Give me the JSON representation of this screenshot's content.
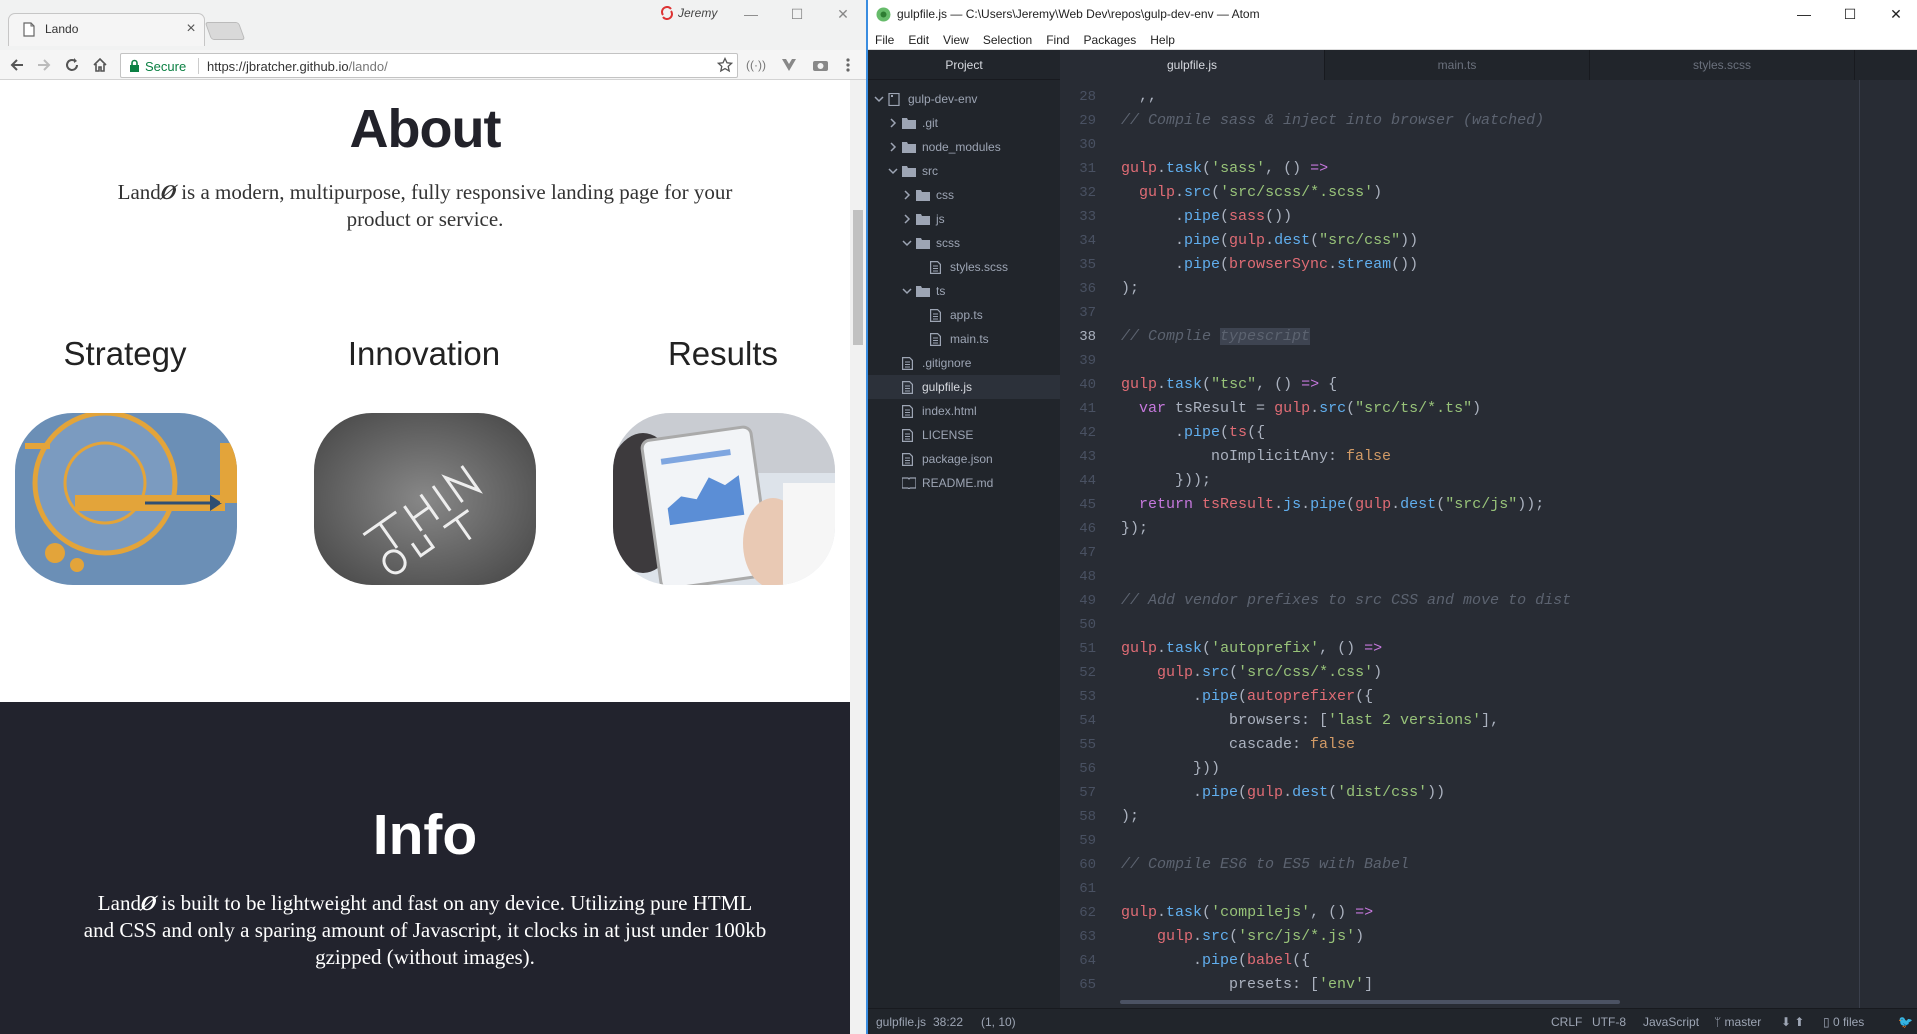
{
  "chrome": {
    "tab_title": "Lando",
    "profile_name": "Jeremy",
    "secure_label": "Secure",
    "url_host": "https://jbratcher.github.io",
    "url_path": "/lando/",
    "controls": {
      "minimize": "—",
      "maximize": "☐",
      "close": "✕"
    }
  },
  "page": {
    "about_title": "About",
    "about_text_prefix": "Land",
    "about_text_rest": " is a modern, multipurpose, fully responsive landing page for your product or service.",
    "features": [
      {
        "title": "Strategy",
        "image": "strategy-image"
      },
      {
        "title": "Innovation",
        "image": "innovation-chalkboard-image"
      },
      {
        "title": "Results",
        "image": "results-tablet-image"
      }
    ],
    "info_title": "Info",
    "info_text_prefix": "Land",
    "info_text_rest": " is built to be lightweight and fast on any device. Utilizing pure HTML and CSS and only a sparing amount of Javascript, it clocks in at just under 100kb gzipped (without images)."
  },
  "atom": {
    "window_title": "gulpfile.js — C:\\Users\\Jeremy\\Web Dev\\repos\\gulp-dev-env — Atom",
    "menu": [
      "File",
      "Edit",
      "View",
      "Selection",
      "Find",
      "Packages",
      "Help"
    ],
    "tree_header": "Project",
    "tree": [
      {
        "label": "gulp-dev-env",
        "type": "repo",
        "depth": 0,
        "expanded": true
      },
      {
        "label": ".git",
        "type": "folder",
        "depth": 1,
        "expanded": false
      },
      {
        "label": "node_modules",
        "type": "folder",
        "depth": 1,
        "expanded": false
      },
      {
        "label": "src",
        "type": "folder",
        "depth": 1,
        "expanded": true
      },
      {
        "label": "css",
        "type": "folder",
        "depth": 2,
        "expanded": false
      },
      {
        "label": "js",
        "type": "folder",
        "depth": 2,
        "expanded": false
      },
      {
        "label": "scss",
        "type": "folder",
        "depth": 2,
        "expanded": true
      },
      {
        "label": "styles.scss",
        "type": "file",
        "depth": 3
      },
      {
        "label": "ts",
        "type": "folder",
        "depth": 2,
        "expanded": true
      },
      {
        "label": "app.ts",
        "type": "file",
        "depth": 3
      },
      {
        "label": "main.ts",
        "type": "file",
        "depth": 3
      },
      {
        "label": ".gitignore",
        "type": "file",
        "depth": 1
      },
      {
        "label": "gulpfile.js",
        "type": "file",
        "depth": 1,
        "selected": true
      },
      {
        "label": "index.html",
        "type": "file",
        "depth": 1
      },
      {
        "label": "LICENSE",
        "type": "file",
        "depth": 1
      },
      {
        "label": "package.json",
        "type": "file",
        "depth": 1
      },
      {
        "label": "README.md",
        "type": "book",
        "depth": 1
      }
    ],
    "tabs": [
      {
        "label": "gulpfile.js",
        "active": true
      },
      {
        "label": "main.ts",
        "active": false
      },
      {
        "label": "styles.scss",
        "active": false
      }
    ],
    "current_line": 38,
    "code": [
      {
        "n": 28,
        "t": [
          [
            "pn",
            "  ,,"
          ]
        ]
      },
      {
        "n": 29,
        "t": [
          [
            "cm",
            "// Compile sass & inject into browser (watched)"
          ]
        ]
      },
      {
        "n": 30,
        "t": []
      },
      {
        "n": 31,
        "t": [
          [
            "fn",
            "gulp"
          ],
          [
            "pn",
            "."
          ],
          [
            "fn",
            "task"
          ],
          [
            "pn",
            "("
          ],
          [
            "st",
            "'sass'"
          ],
          [
            "pn",
            ", () "
          ],
          [
            "kw",
            "=>"
          ]
        ]
      },
      {
        "n": 32,
        "t": [
          [
            "pn",
            "  "
          ],
          [
            "fn",
            "gulp"
          ],
          [
            "pn",
            "."
          ],
          [
            "fn",
            "src"
          ],
          [
            "pn",
            "("
          ],
          [
            "st",
            "'src/scss/*.scss'"
          ],
          [
            "pn",
            ")"
          ]
        ]
      },
      {
        "n": 33,
        "t": [
          [
            "pn",
            "      ."
          ],
          [
            "fn",
            "pipe"
          ],
          [
            "pn",
            "("
          ],
          [
            "fn",
            "sass"
          ],
          [
            "pn",
            "())"
          ]
        ]
      },
      {
        "n": 34,
        "t": [
          [
            "pn",
            "      ."
          ],
          [
            "fn",
            "pipe"
          ],
          [
            "pn",
            "("
          ],
          [
            "fn",
            "gulp"
          ],
          [
            "pn",
            "."
          ],
          [
            "fn",
            "dest"
          ],
          [
            "pn",
            "("
          ],
          [
            "st",
            "\"src/css\""
          ],
          [
            "pn",
            "))"
          ]
        ]
      },
      {
        "n": 35,
        "t": [
          [
            "pn",
            "      ."
          ],
          [
            "fn",
            "pipe"
          ],
          [
            "pn",
            "("
          ],
          [
            "fn",
            "browserSync"
          ],
          [
            "pn",
            "."
          ],
          [
            "fn",
            "stream"
          ],
          [
            "pn",
            "())"
          ]
        ]
      },
      {
        "n": 36,
        "t": [
          [
            "pn",
            ");"
          ]
        ]
      },
      {
        "n": 37,
        "t": []
      },
      {
        "n": 38,
        "t": [
          [
            "cm",
            "// Complie "
          ],
          [
            "hl",
            "typescript"
          ]
        ]
      },
      {
        "n": 39,
        "t": []
      },
      {
        "n": 40,
        "t": [
          [
            "fn",
            "gulp"
          ],
          [
            "pn",
            "."
          ],
          [
            "fn",
            "task"
          ],
          [
            "pn",
            "("
          ],
          [
            "st",
            "\"tsc\""
          ],
          [
            "pn",
            ", () "
          ],
          [
            "kw",
            "=>"
          ],
          [
            "pn",
            " {"
          ]
        ]
      },
      {
        "n": 41,
        "t": [
          [
            "pn",
            "  "
          ],
          [
            "kw",
            "var"
          ],
          [
            "pn",
            " tsResult = "
          ],
          [
            "fn",
            "gulp"
          ],
          [
            "pn",
            "."
          ],
          [
            "fn",
            "src"
          ],
          [
            "pn",
            "("
          ],
          [
            "st",
            "\"src/ts/*.ts\""
          ],
          [
            "pn",
            ")"
          ]
        ]
      },
      {
        "n": 42,
        "t": [
          [
            "pn",
            "      ."
          ],
          [
            "fn",
            "pipe"
          ],
          [
            "pn",
            "("
          ],
          [
            "fn",
            "ts"
          ],
          [
            "pn",
            "({"
          ]
        ]
      },
      {
        "n": 43,
        "t": [
          [
            "pn",
            "          noImplicitAny: "
          ],
          [
            "nm",
            "false"
          ]
        ]
      },
      {
        "n": 44,
        "t": [
          [
            "pn",
            "      }));"
          ]
        ]
      },
      {
        "n": 45,
        "t": [
          [
            "pn",
            "  "
          ],
          [
            "kw",
            "return"
          ],
          [
            "pn",
            " "
          ],
          [
            "fn",
            "tsResult"
          ],
          [
            "pn",
            "."
          ],
          [
            "fn",
            "js"
          ],
          [
            "pn",
            "."
          ],
          [
            "fn",
            "pipe"
          ],
          [
            "pn",
            "("
          ],
          [
            "fn",
            "gulp"
          ],
          [
            "pn",
            "."
          ],
          [
            "fn",
            "dest"
          ],
          [
            "pn",
            "("
          ],
          [
            "st",
            "\"src/js\""
          ],
          [
            "pn",
            "));"
          ]
        ]
      },
      {
        "n": 46,
        "t": [
          [
            "pn",
            "});"
          ]
        ]
      },
      {
        "n": 47,
        "t": []
      },
      {
        "n": 48,
        "t": []
      },
      {
        "n": 49,
        "t": [
          [
            "cm",
            "// Add vendor prefixes to src CSS and move to dist"
          ]
        ]
      },
      {
        "n": 50,
        "t": []
      },
      {
        "n": 51,
        "t": [
          [
            "fn",
            "gulp"
          ],
          [
            "pn",
            "."
          ],
          [
            "fn",
            "task"
          ],
          [
            "pn",
            "("
          ],
          [
            "st",
            "'autoprefix'"
          ],
          [
            "pn",
            ", () "
          ],
          [
            "kw",
            "=>"
          ]
        ]
      },
      {
        "n": 52,
        "t": [
          [
            "pn",
            "    "
          ],
          [
            "fn",
            "gulp"
          ],
          [
            "pn",
            "."
          ],
          [
            "fn",
            "src"
          ],
          [
            "pn",
            "("
          ],
          [
            "st",
            "'src/css/*.css'"
          ],
          [
            "pn",
            ")"
          ]
        ]
      },
      {
        "n": 53,
        "t": [
          [
            "pn",
            "        ."
          ],
          [
            "fn",
            "pipe"
          ],
          [
            "pn",
            "("
          ],
          [
            "fn",
            "autoprefixer"
          ],
          [
            "pn",
            "({"
          ]
        ]
      },
      {
        "n": 54,
        "t": [
          [
            "pn",
            "            browsers: ["
          ],
          [
            "st",
            "'last 2 versions'"
          ],
          [
            "pn",
            "],"
          ]
        ]
      },
      {
        "n": 55,
        "t": [
          [
            "pn",
            "            cascade: "
          ],
          [
            "nm",
            "false"
          ]
        ]
      },
      {
        "n": 56,
        "t": [
          [
            "pn",
            "        }))"
          ]
        ]
      },
      {
        "n": 57,
        "t": [
          [
            "pn",
            "        ."
          ],
          [
            "fn",
            "pipe"
          ],
          [
            "pn",
            "("
          ],
          [
            "fn",
            "gulp"
          ],
          [
            "pn",
            "."
          ],
          [
            "fn",
            "dest"
          ],
          [
            "pn",
            "("
          ],
          [
            "st",
            "'dist/css'"
          ],
          [
            "pn",
            "))"
          ]
        ]
      },
      {
        "n": 58,
        "t": [
          [
            "pn",
            ");"
          ]
        ]
      },
      {
        "n": 59,
        "t": []
      },
      {
        "n": 60,
        "t": [
          [
            "cm",
            "// Compile ES6 to ES5 with Babel"
          ]
        ]
      },
      {
        "n": 61,
        "t": []
      },
      {
        "n": 62,
        "t": [
          [
            "fn",
            "gulp"
          ],
          [
            "pn",
            "."
          ],
          [
            "fn",
            "task"
          ],
          [
            "pn",
            "("
          ],
          [
            "st",
            "'compilejs'"
          ],
          [
            "pn",
            ", () "
          ],
          [
            "kw",
            "=>"
          ]
        ]
      },
      {
        "n": 63,
        "t": [
          [
            "pn",
            "    "
          ],
          [
            "fn",
            "gulp"
          ],
          [
            "pn",
            "."
          ],
          [
            "fn",
            "src"
          ],
          [
            "pn",
            "("
          ],
          [
            "st",
            "'src/js/*.js'"
          ],
          [
            "pn",
            ")"
          ]
        ]
      },
      {
        "n": 64,
        "t": [
          [
            "pn",
            "        ."
          ],
          [
            "fn",
            "pipe"
          ],
          [
            "pn",
            "("
          ],
          [
            "fn",
            "babel"
          ],
          [
            "pn",
            "({"
          ]
        ]
      },
      {
        "n": 65,
        "t": [
          [
            "pn",
            "            presets: ["
          ],
          [
            "st",
            "'env'"
          ],
          [
            "pn",
            "]"
          ]
        ]
      }
    ],
    "status": {
      "file": "gulpfile.js",
      "cursor": "38:22",
      "selection": "(1, 10)",
      "line_ending": "CRLF",
      "encoding": "UTF-8",
      "grammar": "JavaScript",
      "branch": "master",
      "files": "0 files"
    },
    "colors": {
      "cm": "#5c6370",
      "fn": "#e06c75",
      "pn": "#abb2bf",
      "kw": "#c678dd",
      "st": "#98c379",
      "nm": "#d19a66",
      "method": "#61afef"
    }
  }
}
